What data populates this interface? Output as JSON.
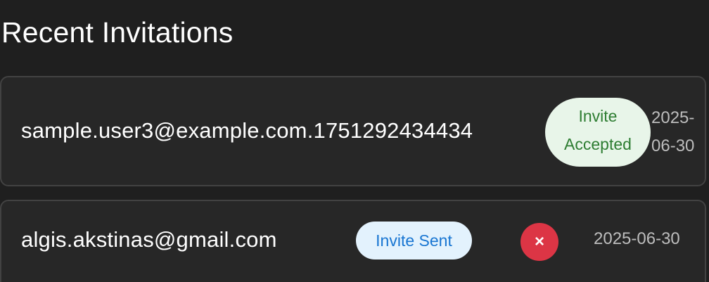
{
  "section": {
    "title": "Recent Invitations"
  },
  "invitations": [
    {
      "email": "sample.user3@example.com.1751292434434",
      "status": "Invite Accepted",
      "date": "2025-06-30",
      "status_color": "#2e7d32",
      "status_bg": "#e8f5e9"
    },
    {
      "email": "algis.akstinas@gmail.com",
      "status": "Invite Sent",
      "date": "2025-06-30",
      "status_color": "#1976d2",
      "status_bg": "#e3f2fd",
      "remove_label": "×",
      "remove_icon": "close-icon",
      "remove_color": "#dc3545"
    }
  ]
}
